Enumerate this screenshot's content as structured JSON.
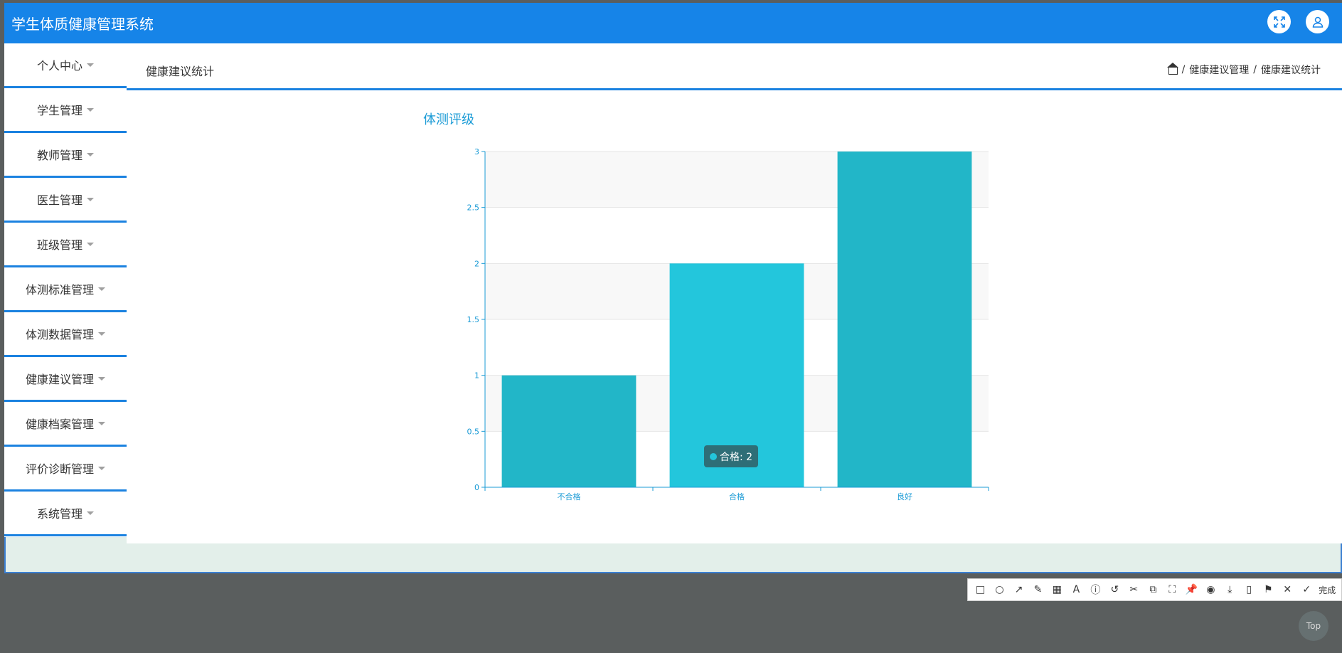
{
  "app": {
    "title": "学生体质健康管理系统"
  },
  "topbar": {
    "fullscreen_icon": "expand-icon",
    "user_icon": "user-icon"
  },
  "sidebar": {
    "items": [
      {
        "label": "个人中心"
      },
      {
        "label": "学生管理"
      },
      {
        "label": "教师管理"
      },
      {
        "label": "医生管理"
      },
      {
        "label": "班级管理"
      },
      {
        "label": "体测标准管理"
      },
      {
        "label": "体测数据管理"
      },
      {
        "label": "健康建议管理"
      },
      {
        "label": "健康档案管理"
      },
      {
        "label": "评价诊断管理"
      },
      {
        "label": "系统管理"
      }
    ]
  },
  "page": {
    "title": "健康建议统计",
    "breadcrumb": {
      "sep": "/",
      "level1": "健康建议管理",
      "level2": "健康建议统计"
    }
  },
  "chart_data": {
    "type": "bar",
    "title": "体测评级",
    "categories": [
      "不合格",
      "合格",
      "良好"
    ],
    "values": [
      1,
      2,
      3
    ],
    "ylim": [
      0,
      3
    ],
    "yticks": [
      "0",
      "0.5",
      "1",
      "1.5",
      "2",
      "2.5",
      "3"
    ],
    "colors": {
      "bar": "#22b6c8",
      "bar_hover": "#23c6dc",
      "axis": "#1b9bd6",
      "band": "#f8f8f8"
    }
  },
  "tooltip": {
    "text": "合格: 2"
  },
  "toolbar": {
    "tools": [
      "□",
      "○",
      "↗",
      "✎",
      "▦",
      "A",
      "ⓘ",
      "↺",
      "✂",
      "⧉",
      "⛶",
      "📌",
      "◉",
      "⤓",
      "▯",
      "⚑",
      "✕",
      "✓"
    ],
    "done_label": "完成"
  },
  "back_to_top": {
    "label": "Top"
  }
}
